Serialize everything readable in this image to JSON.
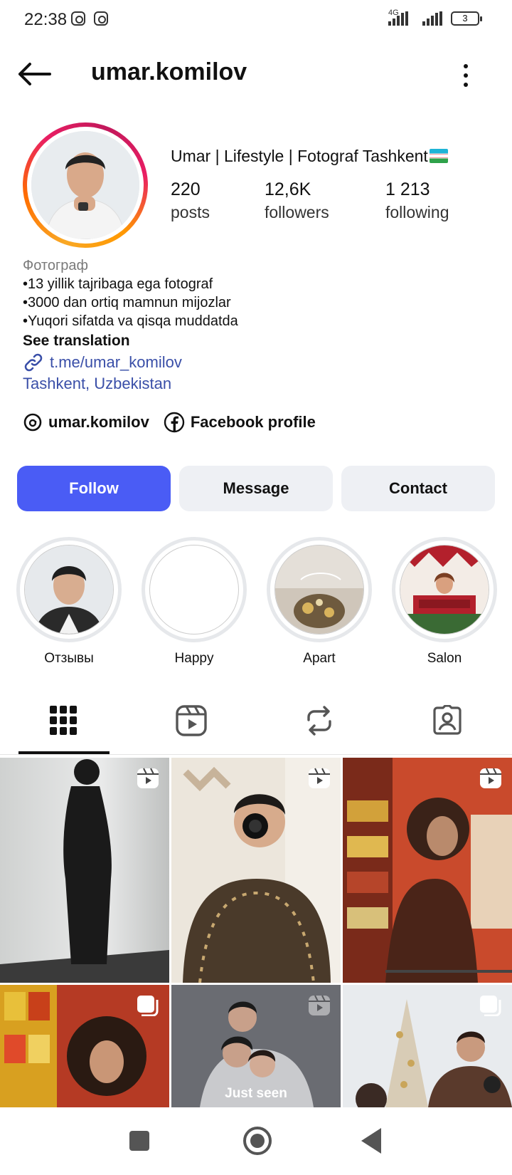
{
  "status_bar": {
    "time": "22:38",
    "network": "4G",
    "battery": "3"
  },
  "header": {
    "username": "umar.komilov",
    "back_icon": "arrow-left-icon",
    "more_icon": "more-vertical-icon"
  },
  "profile": {
    "full_name": "Umar | Lifestyle | Fotograf Tashkent",
    "stats": [
      {
        "value": "220",
        "label": "posts"
      },
      {
        "value": "12,6K",
        "label": "followers"
      },
      {
        "value": "1 213",
        "label": "following"
      }
    ],
    "category": "Фотограф",
    "bio_lines": [
      "•13 yillik tajribaga ega fotograf",
      "•3000 dan ortiq mamnun mijozlar",
      "•Yuqori sifatda va qisqa muddatda"
    ],
    "see_translation": "See translation",
    "link": "t.me/umar_komilov",
    "location": "Tashkent, Uzbekistan",
    "socials": [
      {
        "icon": "threads-icon",
        "label": "umar.komilov"
      },
      {
        "icon": "facebook-icon",
        "label": "Facebook profile"
      }
    ]
  },
  "actions": {
    "follow": "Follow",
    "message": "Message",
    "contact": "Contact"
  },
  "highlights": [
    {
      "label": "Отзывы"
    },
    {
      "label": "Happy"
    },
    {
      "label": "Apart"
    },
    {
      "label": "Salon"
    }
  ],
  "tabs": [
    {
      "icon": "grid-icon",
      "active": true
    },
    {
      "icon": "reels-icon",
      "active": false
    },
    {
      "icon": "reposts-icon",
      "active": false
    },
    {
      "icon": "tagged-icon",
      "active": false
    }
  ],
  "grid": {
    "overlay_text": "Just seen"
  },
  "colors": {
    "accent": "#4a5cf5",
    "link": "#3a4fa8",
    "button_secondary": "#eef0f4"
  }
}
